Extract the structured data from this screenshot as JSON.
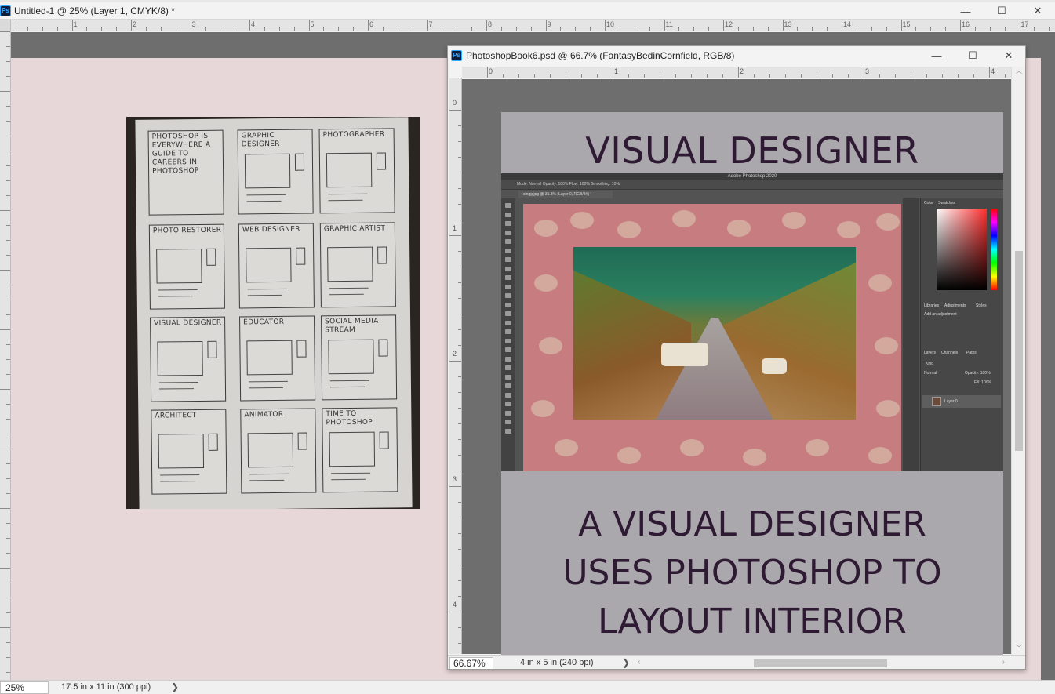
{
  "app": {
    "badge": "Ps"
  },
  "outer_window": {
    "title": "Untitled-1 @ 25% (Layer 1, CMYK/8) *",
    "minimize": "—",
    "maximize": "☐",
    "close": "✕"
  },
  "outer_ruler": {
    "labels": [
      "1",
      "2",
      "3",
      "4",
      "5",
      "6",
      "7",
      "8",
      "9",
      "10",
      "11",
      "12",
      "13",
      "14",
      "15",
      "16",
      "17"
    ]
  },
  "sketch": {
    "panels": [
      {
        "caption": "PHOTOSHOP IS EVERYWHERE A GUIDE TO CAREERS IN PHOTOSHOP"
      },
      {
        "caption": "GRAPHIC DESIGNER"
      },
      {
        "caption": "PHOTOGRAPHER"
      },
      {
        "caption": "PHOTO RESTORER"
      },
      {
        "caption": "WEB DESIGNER"
      },
      {
        "caption": "GRAPHIC ARTIST"
      },
      {
        "caption": "VISUAL DESIGNER"
      },
      {
        "caption": "EDUCATOR"
      },
      {
        "caption": "SOCIAL MEDIA STREAM"
      },
      {
        "caption": "ARCHITECT"
      },
      {
        "caption": "ANIMATOR"
      },
      {
        "caption": "TIME TO PHOTOSHOP"
      }
    ]
  },
  "doc_window": {
    "title": "PhotoshopBook6.psd @ 66.7% (FantasyBedinCornfield, RGB/8)",
    "minimize": "—",
    "maximize": "☐",
    "close": "✕",
    "ruler_h_labels": [
      "0",
      "1",
      "2",
      "3",
      "4"
    ],
    "ruler_v_labels": [
      "0",
      "1",
      "2",
      "3",
      "4"
    ],
    "zoom": "66.67%",
    "doc_info": "4 in x 5 in (240 ppi)",
    "status_chevron": "❯"
  },
  "page": {
    "heading": "VISUAL DESIGNER",
    "body": "A VISUAL DESIGNER USES PHOTOSHOP TO LAYOUT INTERIOR SPACES"
  },
  "embedded_screenshot": {
    "app_title": "Adobe Photoshop 2020",
    "options_bar": "Mode: Normal   Opacity: 100%   Flow: 100%   Smoothing: 10%",
    "tab": "singg.jpg @ 31.3% (Layer 0, RGB/8#) *",
    "panel_tabs": {
      "color": "Color",
      "swatches": "Swatches",
      "libraries": "Libraries",
      "adjustments": "Adjustments",
      "styles": "Styles",
      "add_adjustment": "Add an adjustment",
      "layers": "Layers",
      "channels": "Channels",
      "paths": "Paths",
      "blend": "Normal",
      "opacity": "Opacity: 100%",
      "fill": "Fill: 100%",
      "kind": "Kind"
    },
    "layer_name": "Layer 0"
  },
  "status_bar": {
    "zoom": "25%",
    "doc_info": "17.5 in x 11 in (300 ppi)",
    "chevron": "❯"
  }
}
